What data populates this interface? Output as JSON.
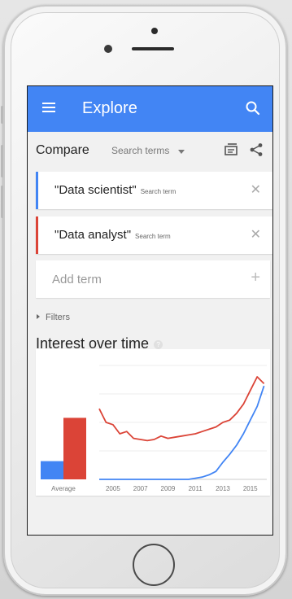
{
  "appbar": {
    "title": "Explore"
  },
  "compare": {
    "title": "Compare",
    "select_label": "Search terms"
  },
  "terms": [
    {
      "label": "\"Data scientist\"",
      "sub": "Search term",
      "color": "#4285f4"
    },
    {
      "label": "\"Data analyst\"",
      "sub": "Search term",
      "color": "#db4437"
    }
  ],
  "add_term": {
    "label": "Add term"
  },
  "filters": {
    "label": "Filters"
  },
  "interest": {
    "title": "Interest over time"
  },
  "chart_data": {
    "type": "line",
    "xlabel": "",
    "ylabel": "",
    "x_ticks": [
      "2005",
      "2007",
      "2009",
      "2011",
      "2013",
      "2015"
    ],
    "average_label": "Average",
    "ylim": [
      0,
      100
    ],
    "averages": [
      {
        "name": "\"Data scientist\"",
        "value": 16,
        "color": "#4285f4"
      },
      {
        "name": "\"Data analyst\"",
        "value": 54,
        "color": "#db4437"
      }
    ],
    "series": [
      {
        "name": "\"Data analyst\"",
        "color": "#db4437",
        "x": [
          2004.0,
          2004.5,
          2005.0,
          2005.5,
          2006.0,
          2006.5,
          2007.0,
          2007.5,
          2008.0,
          2008.5,
          2009.0,
          2009.5,
          2010.0,
          2010.5,
          2011.0,
          2011.5,
          2012.0,
          2012.5,
          2013.0,
          2013.5,
          2014.0,
          2014.5,
          2015.0,
          2015.5,
          2016.0
        ],
        "values": [
          62,
          50,
          48,
          40,
          42,
          36,
          35,
          34,
          35,
          38,
          36,
          37,
          38,
          39,
          40,
          42,
          44,
          46,
          50,
          52,
          58,
          66,
          78,
          90,
          84
        ]
      },
      {
        "name": "\"Data scientist\"",
        "color": "#4285f4",
        "x": [
          2004.0,
          2005.0,
          2006.0,
          2007.0,
          2008.0,
          2009.0,
          2010.0,
          2010.5,
          2011.0,
          2011.5,
          2012.0,
          2012.5,
          2013.0,
          2013.5,
          2014.0,
          2014.5,
          2015.0,
          2015.5,
          2016.0
        ],
        "values": [
          0,
          0,
          0,
          0,
          0,
          0,
          0,
          0,
          1,
          2,
          4,
          7,
          15,
          22,
          30,
          40,
          52,
          64,
          82
        ]
      }
    ]
  }
}
